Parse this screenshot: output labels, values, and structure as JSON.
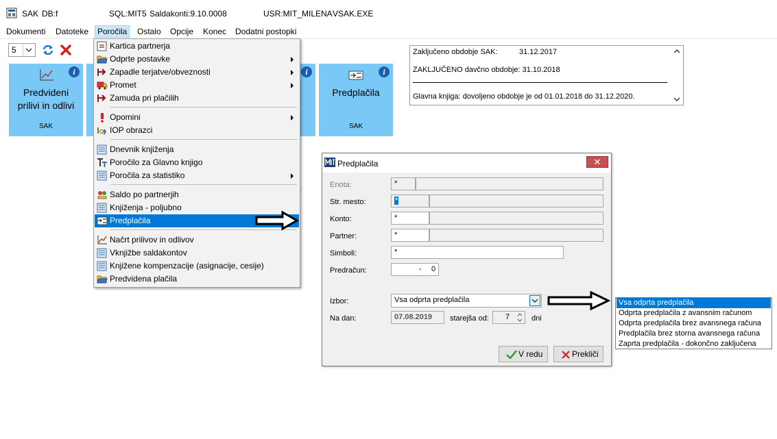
{
  "titlebar": {
    "app": "SAK",
    "db": "DB:f",
    "sql": "SQL:MIT5",
    "version": "Saldakonti:9.10.0008",
    "user": "USR:MIT_MILENA",
    "exe": "VSAK.EXE"
  },
  "menubar": [
    "Dokumenti",
    "Datoteke",
    "Poročila",
    "Ostalo",
    "Opcije",
    "Konec",
    "Dodatni postopki"
  ],
  "toolbar": {
    "page_value": "5"
  },
  "tiles": [
    {
      "label1": "Predvideni",
      "label2": "prilivi in odlivi",
      "sub": "SAK",
      "info": "i"
    },
    {
      "info": "i"
    },
    {
      "label1": "Predplačila",
      "sub": "SAK",
      "info": "i"
    }
  ],
  "infobox": {
    "line1_label": "Zaključeno obdobje SAK:",
    "line1_value": "31.12.2017",
    "line2": "ZAKLJUČENO davčno obdobje: 31.10.2018",
    "line3": "Glavna knjiga: dovoljeno obdobje je od 01.01.2018 do 31.12.2020."
  },
  "menu": {
    "items": [
      {
        "label": "Kartica partnerja",
        "icon": "card-icon"
      },
      {
        "label": "Odprte postavke",
        "icon": "open-folder-icon",
        "submenu": true
      },
      {
        "label": "Zapadle terjatve/obveznosti",
        "icon": "arrow-right-icon",
        "submenu": true
      },
      {
        "label": "Promet",
        "icon": "truck-icon",
        "submenu": true
      },
      {
        "label": "Zamuda pri plačilih",
        "icon": "arrow-right-icon"
      },
      {
        "label": "Opomini",
        "icon": "exclamation-icon",
        "submenu": true
      },
      {
        "label": "IOP obrazci",
        "icon": "iop-icon"
      },
      {
        "label": "Dnevnik knjiženja",
        "icon": "list-icon"
      },
      {
        "label": "Poročilo za Glavno knjigo",
        "icon": "text-icon"
      },
      {
        "label": "Poročila za statistiko",
        "icon": "list-icon",
        "submenu": true
      },
      {
        "label": "Saldo po partnerjih",
        "icon": "balance-icon"
      },
      {
        "label": "Knjiženja - poljubno",
        "icon": "list-icon"
      },
      {
        "label": "Predplačila",
        "icon": "prepayment-icon",
        "selected": true
      },
      {
        "label": "Načrt prilivov in odlivov",
        "icon": "chart-icon"
      },
      {
        "label": "Vknjižbe saldakontov",
        "icon": "list-icon"
      },
      {
        "label": "Knjižene kompenzacije (asignacije, cesije)",
        "icon": "list-icon"
      },
      {
        "label": "Predvidena plačila",
        "icon": "open-folder-icon"
      }
    ]
  },
  "dialog": {
    "title": "Predplačila",
    "close": "✕",
    "fields": {
      "enota": {
        "label": "Enota:",
        "value": "*"
      },
      "str_mesto": {
        "label": "Str. mesto:",
        "value": "*"
      },
      "konto": {
        "label": "Konto:",
        "value": "*"
      },
      "partner": {
        "label": "Partner:",
        "value": "*"
      },
      "simboli": {
        "label": "Simboli:",
        "value": "*"
      },
      "predracun": {
        "label": "Predračun:",
        "value": "-",
        "value2": "0"
      },
      "izbor": {
        "label": "Izbor:",
        "value": "Vsa odprta predplačila"
      },
      "na_dan": {
        "label": "Na dan:",
        "value": "07.08.2019"
      },
      "starejsa": {
        "label": "starejša od:",
        "value": "7",
        "unit": "dni"
      }
    },
    "ok": "V redu",
    "cancel": "Prekliči"
  },
  "izbor_options": [
    "Vsa odprta predplačila",
    "Odprta predplačila z avansnim računom",
    "Odprta predplačila brez avansnega računa",
    "Predplačila brez storna avansnega računa",
    "Zaprta predplačila - dokončno zaključena"
  ],
  "colors": {
    "tile": "#79c8f6",
    "selection": "#0078d7",
    "close": "#c75050"
  }
}
